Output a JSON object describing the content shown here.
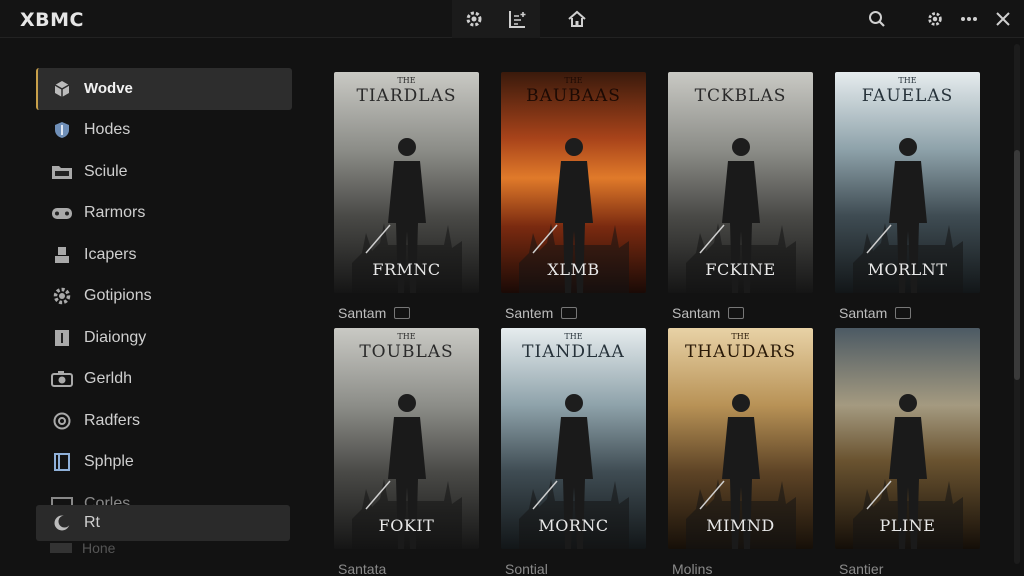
{
  "app": {
    "logo": "XBMC"
  },
  "toolbar": {
    "icons": [
      "gear-icon",
      "library-icon"
    ],
    "home_icon": "home-icon",
    "right_icons": [
      "search-icon",
      "settings-icon",
      "more-icon",
      "close-icon"
    ]
  },
  "sidebar": {
    "items": [
      {
        "label": "Wodve",
        "icon": "cube-icon",
        "active": true
      },
      {
        "label": "Hodes",
        "icon": "shield-icon"
      },
      {
        "label": "Sciule",
        "icon": "folder-icon"
      },
      {
        "label": "Rarmors",
        "icon": "gamepad-icon"
      },
      {
        "label": "Icapers",
        "icon": "person-icon"
      },
      {
        "label": "Gotipions",
        "icon": "gear-icon"
      },
      {
        "label": "Diaiongy",
        "icon": "book-icon"
      },
      {
        "label": "Gerldh",
        "icon": "camera-icon"
      },
      {
        "label": "Radfers",
        "icon": "at-icon"
      },
      {
        "label": "Sphple",
        "icon": "bookmark-icon"
      },
      {
        "label": "Corles",
        "icon": "box-icon",
        "dim": true
      }
    ],
    "overlay_label": "Rt",
    "ghost_label": "Hone"
  },
  "posters": [
    {
      "title": "TIARDLAS",
      "pre": "THE",
      "sub": "FRMNC",
      "caption": "Santam",
      "theme": "grey"
    },
    {
      "title": "BAUBAAS",
      "pre": "THE",
      "sub": "XLMB",
      "caption": "Santem",
      "theme": "fire"
    },
    {
      "title": "TCKBLAS",
      "pre": "",
      "sub": "FCKINE",
      "caption": "Santam",
      "theme": "grey"
    },
    {
      "title": "FAUELAS",
      "pre": "THE",
      "sub": "MORLNT",
      "caption": "Santam",
      "theme": "blue"
    },
    {
      "title": "TOUBLAS",
      "pre": "THE",
      "sub": "FOKIT",
      "caption": "Santata",
      "theme": "grey"
    },
    {
      "title": "TIANDLAA",
      "pre": "THE",
      "sub": "MORNC",
      "caption": "Sontial",
      "theme": "blue"
    },
    {
      "title": "THAUDARS",
      "pre": "THE",
      "sub": "MIMND",
      "caption": "Molins",
      "theme": "sepia"
    },
    {
      "title": "",
      "pre": "",
      "sub": "PLINE",
      "caption": "Santier",
      "theme": "storm"
    }
  ],
  "colors": {
    "accent": "#c8a04a",
    "bg": "#121212",
    "sidebar_active": "#2d2d2d"
  }
}
